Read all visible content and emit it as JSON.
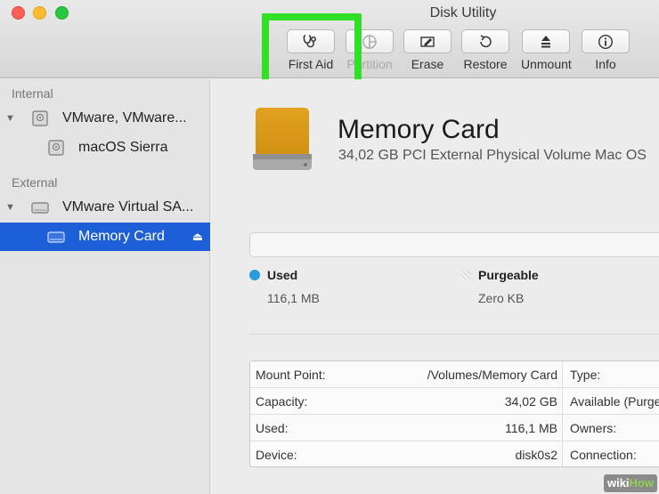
{
  "window": {
    "title": "Disk Utility"
  },
  "toolbar": {
    "items": [
      {
        "label": "First Aid",
        "icon": "stethoscope-icon",
        "enabled": true
      },
      {
        "label": "Partition",
        "icon": "partition-icon",
        "enabled": false
      },
      {
        "label": "Erase",
        "icon": "erase-icon",
        "enabled": true
      },
      {
        "label": "Restore",
        "icon": "restore-icon",
        "enabled": true
      },
      {
        "label": "Unmount",
        "icon": "unmount-icon",
        "enabled": true
      },
      {
        "label": "Info",
        "icon": "info-icon",
        "enabled": true
      }
    ],
    "highlight_color": "#31e026"
  },
  "sidebar": {
    "internal_label": "Internal",
    "external_label": "External",
    "internal_items": [
      {
        "name": "VMware, VMware..."
      },
      {
        "name": "macOS Sierra"
      }
    ],
    "external_items": [
      {
        "name": "VMware Virtual SA..."
      },
      {
        "name": "Memory Card",
        "selected": true
      }
    ],
    "selection_color": "#1d5fd6"
  },
  "main": {
    "disk_name": "Memory Card",
    "disk_subtitle": "34,02 GB PCI External Physical Volume Mac OS",
    "used_label": "Used",
    "used_value": "116,1 MB",
    "used_color": "#2a9be0",
    "purgeable_label": "Purgeable",
    "purgeable_value": "Zero KB",
    "info_rows": [
      {
        "key": "Mount Point:",
        "value": "/Volumes/Memory Card",
        "key2": "Type:"
      },
      {
        "key": "Capacity:",
        "value": "34,02 GB",
        "key2": "Available (Purge"
      },
      {
        "key": "Used:",
        "value": "116,1 MB",
        "key2": "Owners:"
      },
      {
        "key": "Device:",
        "value": "disk0s2",
        "key2": "Connection:"
      }
    ]
  },
  "watermark": {
    "part1": "wiki",
    "part2": "How"
  }
}
